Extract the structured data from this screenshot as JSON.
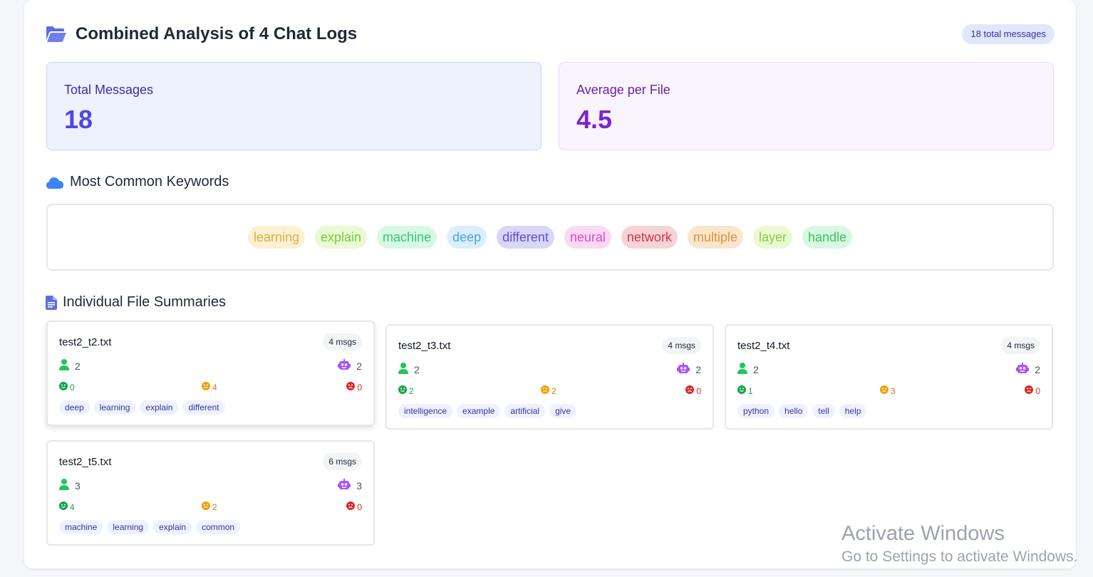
{
  "header": {
    "title": "Combined Analysis of 4 Chat Logs",
    "total_badge": "18 total messages"
  },
  "stats": {
    "total_label": "Total Messages",
    "total_value": "18",
    "avg_label": "Average per File",
    "avg_value": "4.5"
  },
  "keywords": {
    "title": "Most Common Keywords",
    "items": [
      {
        "text": "learning",
        "bg": "#fbf1d0",
        "fg": "#d4b14a"
      },
      {
        "text": "explain",
        "bg": "#e8f9d4",
        "fg": "#7cc93e"
      },
      {
        "text": "machine",
        "bg": "#d8f7e4",
        "fg": "#34c774"
      },
      {
        "text": "deep",
        "bg": "#dbeefb",
        "fg": "#4aa3e0"
      },
      {
        "text": "different",
        "bg": "#d9d6f8",
        "fg": "#5b4fd0"
      },
      {
        "text": "neural",
        "bg": "#fbd8f4",
        "fg": "#d64fc2"
      },
      {
        "text": "network",
        "bg": "#f7d3d6",
        "fg": "#c9374a"
      },
      {
        "text": "multiple",
        "bg": "#fbe6cc",
        "fg": "#d9943a"
      },
      {
        "text": "layer",
        "bg": "#eaf9d2",
        "fg": "#8bc93e"
      },
      {
        "text": "handle",
        "bg": "#d9f7e0",
        "fg": "#3bc463"
      }
    ]
  },
  "files": {
    "title": "Individual File Summaries",
    "items": [
      {
        "name": "test2_t2.txt",
        "msgs": "4 msgs",
        "users": "2",
        "bots": "2",
        "pos": "0",
        "neu": "4",
        "neg": "0",
        "keywords": [
          "deep",
          "learning",
          "explain",
          "different"
        ]
      },
      {
        "name": "test2_t3.txt",
        "msgs": "4 msgs",
        "users": "2",
        "bots": "2",
        "pos": "2",
        "neu": "2",
        "neg": "0",
        "keywords": [
          "intelligence",
          "example",
          "artificial",
          "give"
        ]
      },
      {
        "name": "test2_t4.txt",
        "msgs": "4 msgs",
        "users": "2",
        "bots": "2",
        "pos": "1",
        "neu": "3",
        "neg": "0",
        "keywords": [
          "python",
          "hello",
          "tell",
          "help"
        ]
      },
      {
        "name": "test2_t5.txt",
        "msgs": "6 msgs",
        "users": "3",
        "bots": "3",
        "pos": "4",
        "neu": "2",
        "neg": "0",
        "keywords": [
          "machine",
          "learning",
          "explain",
          "common"
        ]
      }
    ]
  },
  "watermark": {
    "line1": "Activate Windows",
    "line2": "Go to Settings to activate Windows."
  },
  "colors": {
    "accent": "#4f46e5",
    "purple": "#7e22ce",
    "positive": "#16a34a",
    "neutral": "#d97706",
    "negative": "#dc2626"
  }
}
